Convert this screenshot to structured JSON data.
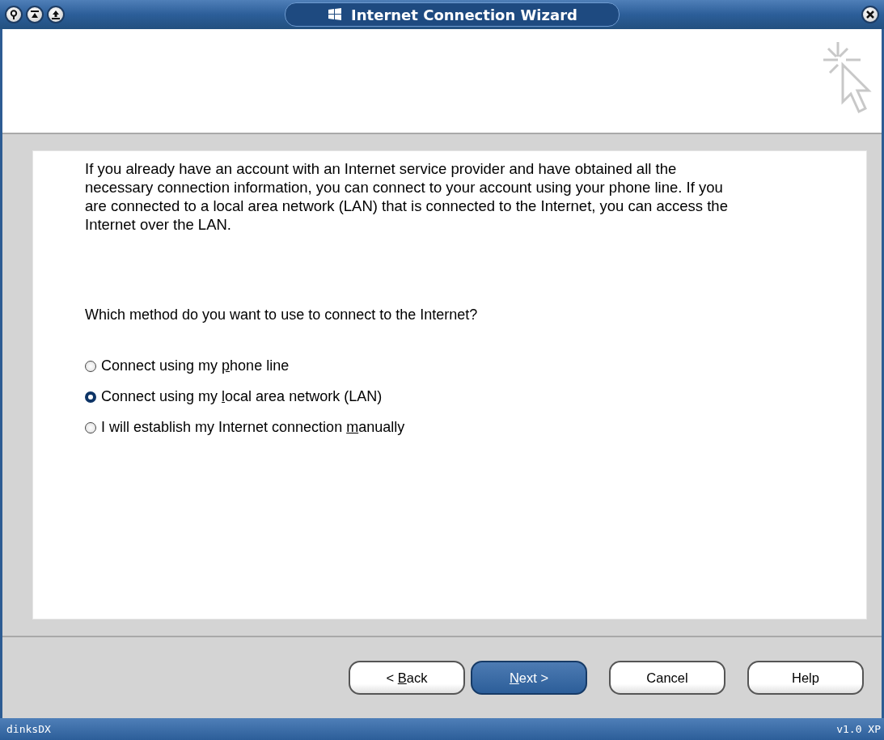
{
  "window": {
    "title": "Internet Connection Wizard"
  },
  "intro": "If you already have an account with an Internet service provider and have obtained all the necessary connection information, you can connect to your account using your phone line. If you are connected to a local area network (LAN) that is connected to the Internet, you can access the Internet over the LAN.",
  "question": "Which method do you want to use to connect to the Internet?",
  "options": [
    {
      "label": {
        "before": "Connect using my ",
        "key": "p",
        "after": "hone line"
      },
      "selected": false
    },
    {
      "label": {
        "before": "Connect using my ",
        "key": "l",
        "after": "ocal area network (LAN)"
      },
      "selected": true
    },
    {
      "label": {
        "before": "I will establish my Internet connection ",
        "key": "m",
        "after": "anually"
      },
      "selected": false
    }
  ],
  "buttons": [
    {
      "label": {
        "before": "< ",
        "key": "B",
        "after": "ack"
      },
      "default": false
    },
    {
      "label": {
        "key": "N",
        "after": "ext >"
      },
      "default": true
    },
    {
      "label": {
        "before": "Cancel"
      },
      "default": false
    },
    {
      "label": {
        "before": "Help"
      },
      "default": false
    }
  ],
  "status_bar": {
    "left": "dinksDX",
    "right": "v1.0 XP"
  }
}
